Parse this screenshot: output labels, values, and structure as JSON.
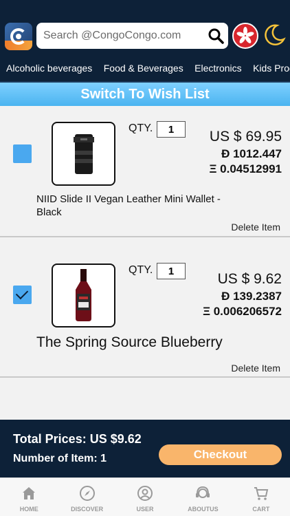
{
  "header": {
    "search_placeholder": "Search @CongoCongo.com",
    "logo_icon": "congo-logo-icon",
    "flag_icon": "hong-kong-flag-icon",
    "theme_icon": "moon-icon"
  },
  "categories": [
    "Alcoholic beverages",
    "Food & Beverages",
    "Electronics",
    "Kids Produ"
  ],
  "wish_bar": {
    "label": "Switch To Wish List"
  },
  "cart_items": [
    {
      "checked": false,
      "qty_label": "QTY.",
      "qty": "1",
      "price_usd": "US $ 69.95",
      "price_dash": "Đ 1012.447",
      "price_eth": "Ξ 0.04512991",
      "name": "NIID Slide II Vegan Leather Mini Wallet - Black",
      "delete_label": "Delete Item"
    },
    {
      "checked": true,
      "qty_label": "QTY.",
      "qty": "1",
      "price_usd": "US $ 9.62",
      "price_dash": "Đ 139.2387",
      "price_eth": "Ξ 0.006206572",
      "name": "The Spring Source Blueberry",
      "delete_label": "Delete Item"
    }
  ],
  "summary": {
    "total_label": "Total Prices: US $9.62",
    "count_label": "Number of Item:  1",
    "checkout_label": "Checkout"
  },
  "tabbar": [
    {
      "label": "HOME",
      "icon": "home-icon"
    },
    {
      "label": "DISCOVER",
      "icon": "compass-icon"
    },
    {
      "label": "USER",
      "icon": "user-icon"
    },
    {
      "label": "ABOUTUS",
      "icon": "support-headset-icon"
    },
    {
      "label": "CART",
      "icon": "cart-icon"
    }
  ],
  "colors": {
    "header_bg": "#0d2138",
    "accent_blue": "#4aa8ef",
    "checkout_orange": "#f9b56b"
  }
}
